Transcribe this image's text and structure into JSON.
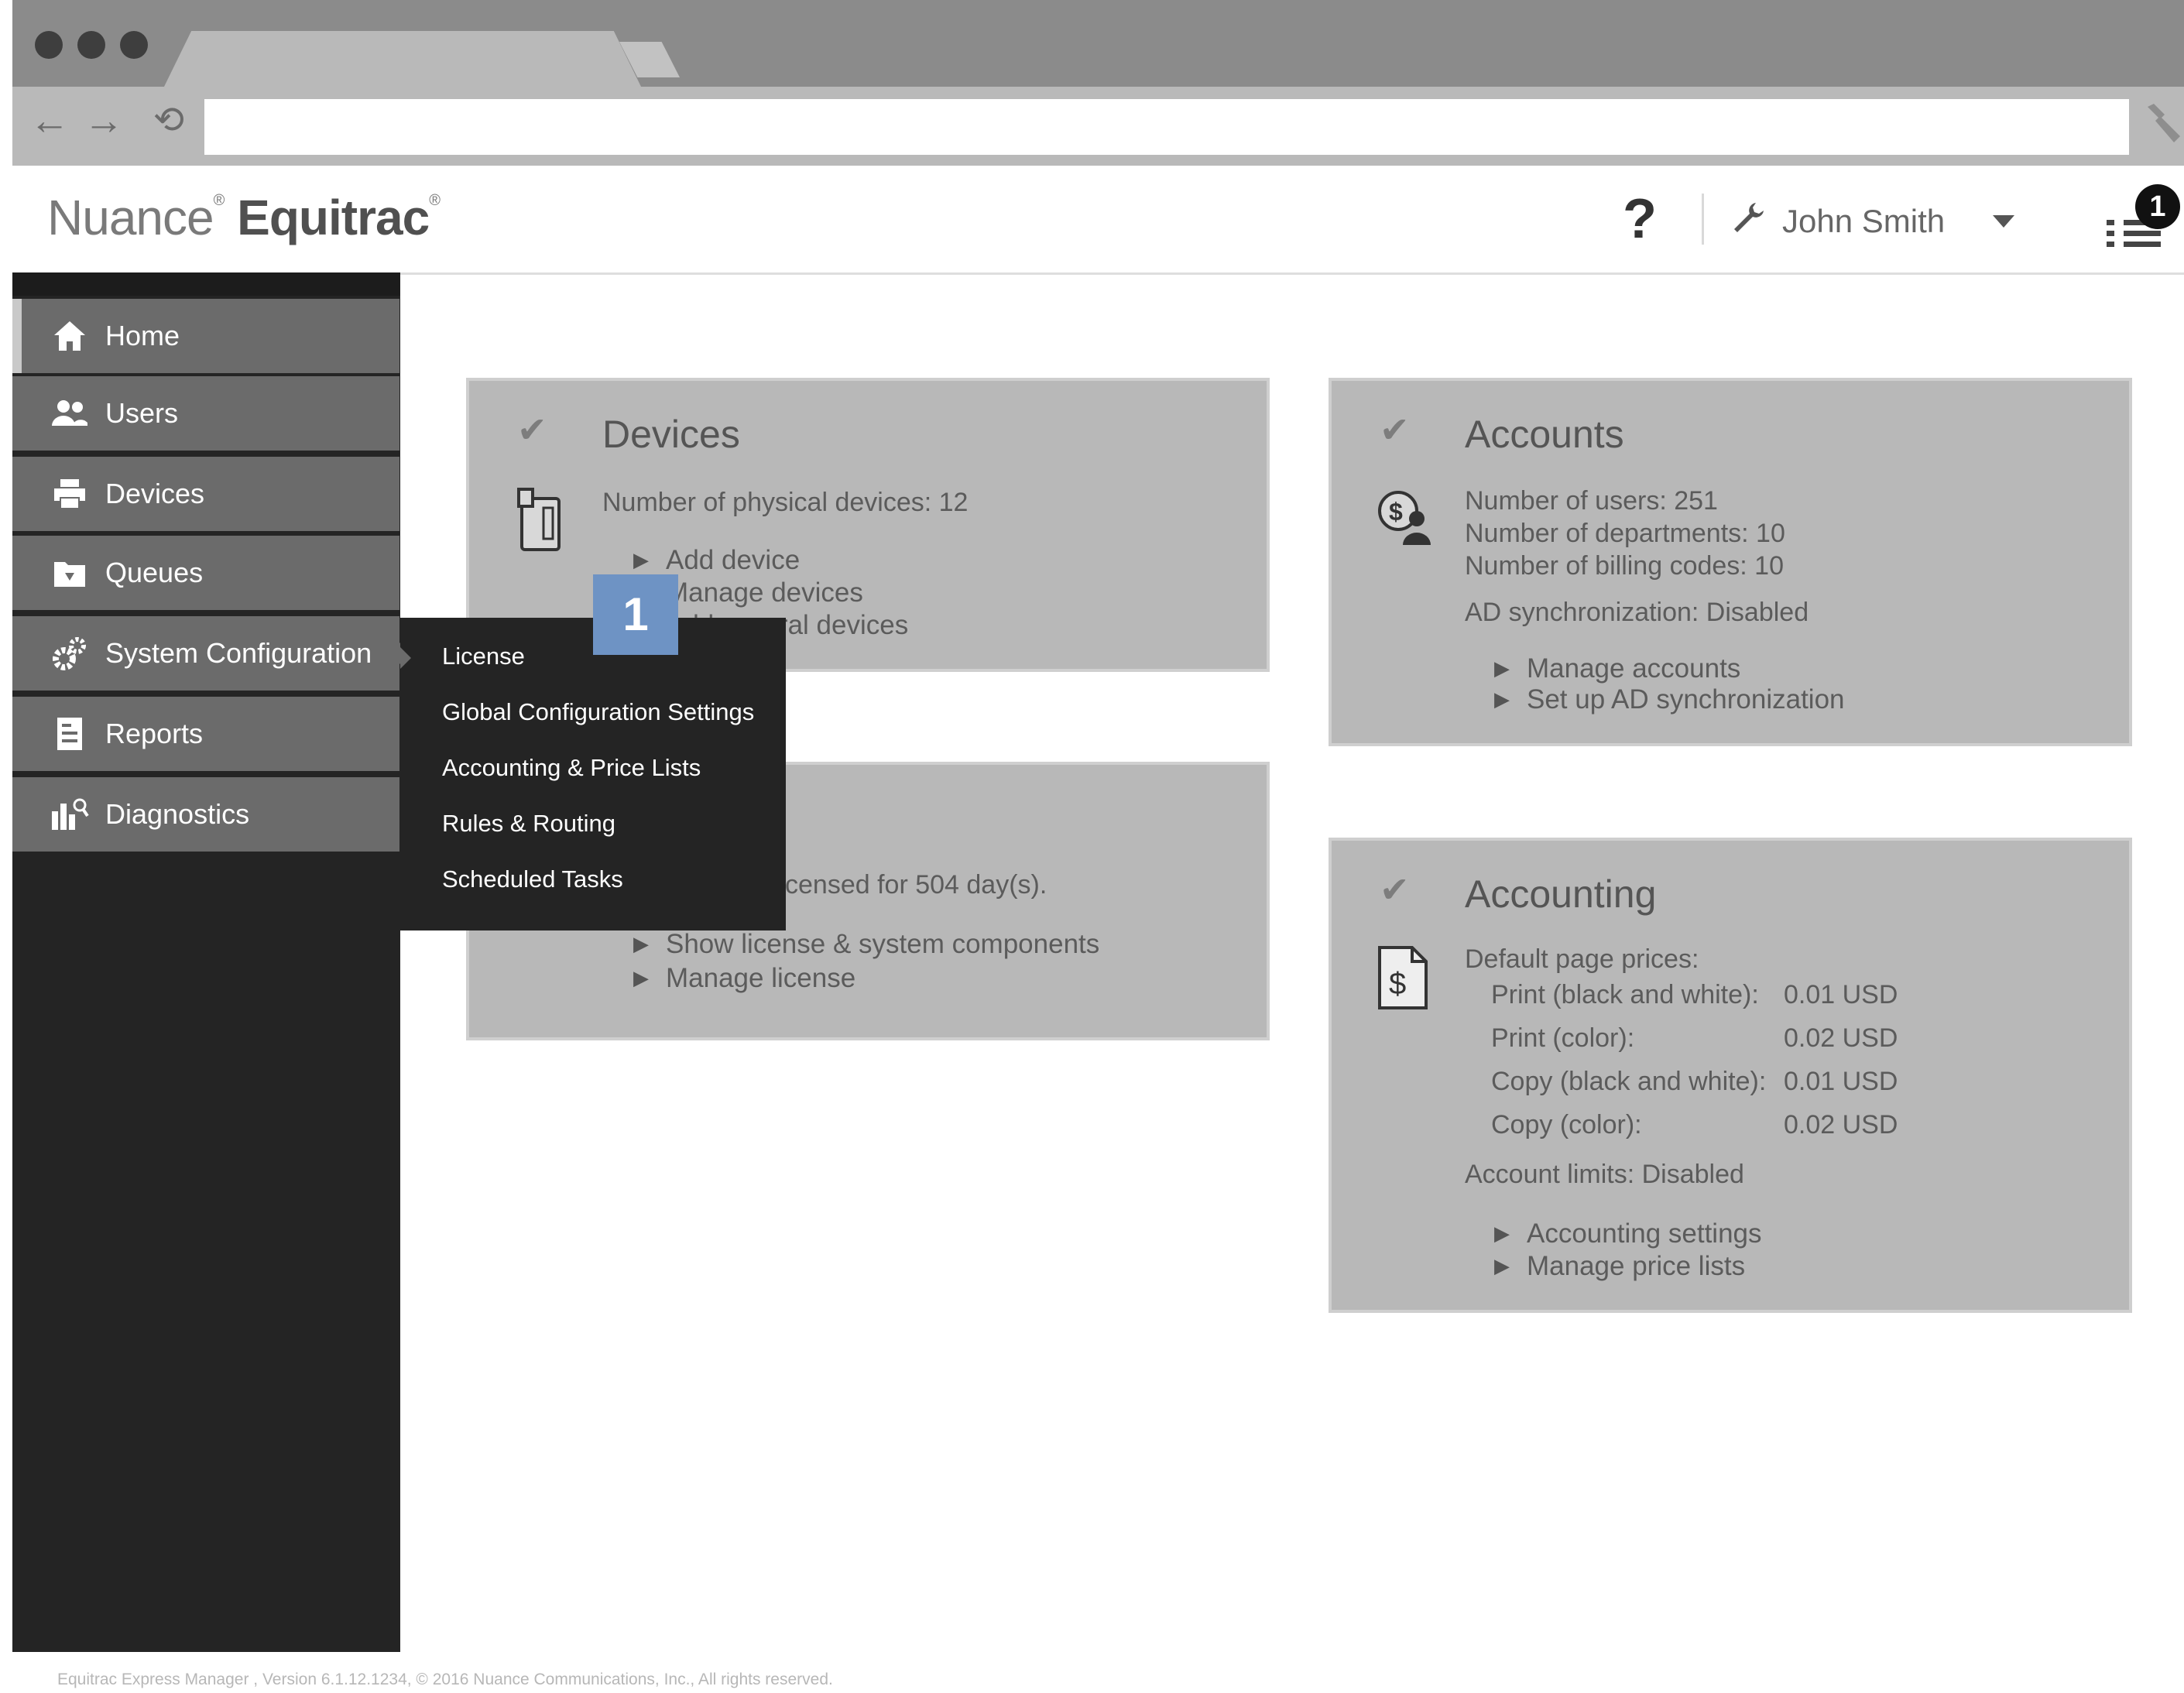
{
  "header": {
    "logo_light": "Nuance",
    "logo_bold": "Equitrac",
    "help_label": "?",
    "user_name": "John Smith",
    "notification_count": "1"
  },
  "sidebar": {
    "items": [
      {
        "label": "Home",
        "icon": "home-icon"
      },
      {
        "label": "Users",
        "icon": "users-icon"
      },
      {
        "label": "Devices",
        "icon": "printer-icon"
      },
      {
        "label": "Queues",
        "icon": "queue-folder-icon"
      },
      {
        "label": "System Configuration",
        "icon": "gears-icon"
      },
      {
        "label": "Reports",
        "icon": "report-icon"
      },
      {
        "label": "Diagnostics",
        "icon": "diagnostics-icon"
      }
    ]
  },
  "flyout": {
    "items": [
      "License",
      "Global Configuration Settings",
      "Accounting & Price Lists",
      "Rules & Routing",
      "Scheduled Tasks"
    ]
  },
  "step_badge": "1",
  "devices_card": {
    "title": "Devices",
    "count_text": "Number of physical devices: 12",
    "links": [
      "Add device",
      "Manage devices",
      "Add several devices"
    ]
  },
  "license_card": {
    "status_text": "censed for 504 day(s).",
    "links": [
      "Show license & system components",
      "Manage license"
    ]
  },
  "accounts_card": {
    "title": "Accounts",
    "stats": [
      "Number of users: 251",
      "Number of departments: 10",
      "Number of billing codes: 10"
    ],
    "ad_sync": "AD synchronization: Disabled",
    "links": [
      "Manage accounts",
      "Set up AD synchronization"
    ]
  },
  "accounting_card": {
    "title": "Accounting",
    "prices_heading": "Default page prices:",
    "prices": [
      {
        "label": "Print (black and white):",
        "value": "0.01 USD"
      },
      {
        "label": "Print (color):",
        "value": "0.02 USD"
      },
      {
        "label": "Copy (black and white):",
        "value": "0.01 USD"
      },
      {
        "label": "Copy (color):",
        "value": "0.02 USD"
      }
    ],
    "limits": "Account limits: Disabled",
    "links": [
      "Accounting settings",
      "Manage price lists"
    ]
  },
  "footer": {
    "text": "Equitrac Express Manager , Version 6.1.12.1234, © 2016 Nuance Communications, Inc., All rights reserved."
  },
  "colors": {
    "sidebar_bg": "#242424",
    "nav_item_bg": "#6b6b6b",
    "card_bg": "#b8b8b8",
    "step_badge": "#6e93c4"
  }
}
